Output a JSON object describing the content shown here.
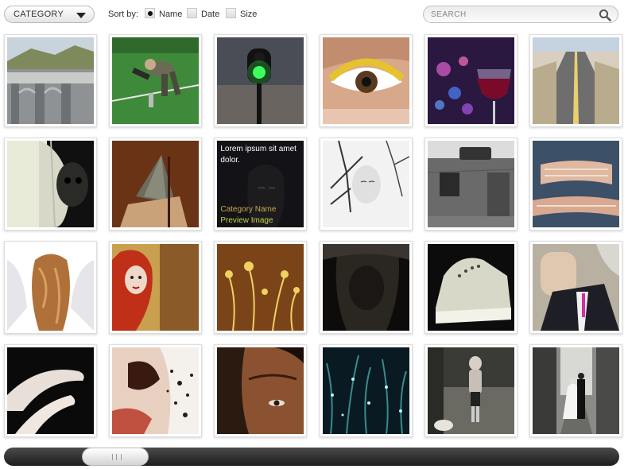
{
  "toolbar": {
    "category_label": "CATEGORY",
    "sort_label": "Sort by:",
    "sort_options": [
      {
        "label": "Name",
        "checked": true
      },
      {
        "label": "Date",
        "checked": false
      },
      {
        "label": "Size",
        "checked": false
      }
    ],
    "search_placeholder": "SEARCH"
  },
  "hover_overlay": {
    "caption": "Lorem ipsum sit amet dolor.",
    "category": "Category Name",
    "preview": "Preview Image"
  },
  "gallery": [
    {
      "name": "photo-concrete-bridge",
      "scene": "bridge"
    },
    {
      "name": "photo-sports-photographer",
      "scene": "photographer"
    },
    {
      "name": "photo-traffic-light",
      "scene": "traffic"
    },
    {
      "name": "photo-eye-closeup",
      "scene": "eye"
    },
    {
      "name": "photo-wine-glass-bokeh",
      "scene": "wine"
    },
    {
      "name": "photo-desert-road",
      "scene": "road"
    },
    {
      "name": "photo-dark-portrait",
      "scene": "darkface"
    },
    {
      "name": "photo-pyramid-head",
      "scene": "pyramid"
    },
    {
      "name": "photo-woman-sketch",
      "scene": "sketch"
    },
    {
      "name": "photo-tree-face",
      "scene": "treeface"
    },
    {
      "name": "photo-wall-suitcase",
      "scene": "wall"
    },
    {
      "name": "photo-torn-jeans",
      "scene": "jeans"
    },
    {
      "name": "photo-angel-wings",
      "scene": "angel"
    },
    {
      "name": "photo-red-hair-girl",
      "scene": "redhair"
    },
    {
      "name": "photo-floral-pattern",
      "scene": "floral"
    },
    {
      "name": "photo-hooded-figure",
      "scene": "hood"
    },
    {
      "name": "photo-converse-sneaker",
      "scene": "sneaker"
    },
    {
      "name": "photo-headless-man",
      "scene": "headless"
    },
    {
      "name": "photo-legs",
      "scene": "legs"
    },
    {
      "name": "photo-freckled-face",
      "scene": "freckles"
    },
    {
      "name": "photo-woman-face-dark",
      "scene": "womanface"
    },
    {
      "name": "photo-dewy-grass",
      "scene": "grass"
    },
    {
      "name": "photo-girl-with-dog",
      "scene": "girldog"
    },
    {
      "name": "photo-wedding-couple",
      "scene": "wedding"
    }
  ],
  "scrollbar": {
    "position": 0.12
  }
}
